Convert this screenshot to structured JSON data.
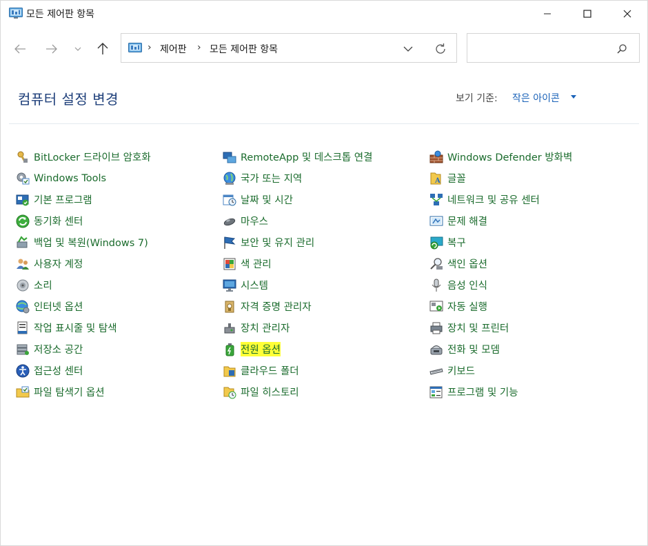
{
  "window": {
    "title": "모든 제어판 항목",
    "controls": [
      "minimize",
      "maximize",
      "close"
    ]
  },
  "nav": {
    "back_icon": "arrow-left-icon",
    "forward_icon": "arrow-right-icon",
    "recent_icon": "chevron-down-icon",
    "up_icon": "arrow-up-icon"
  },
  "address": {
    "crumbs": [
      "제어판",
      "모든 제어판 항목"
    ],
    "separator": "›"
  },
  "search": {
    "placeholder": ""
  },
  "header": {
    "title": "컴퓨터 설정 변경",
    "view_label": "보기 기준:",
    "view_value": "작은 아이콘"
  },
  "columns": [
    [
      {
        "label": "BitLocker 드라이브 암호화",
        "icon": "bitlocker-key-icon"
      },
      {
        "label": "Windows Tools",
        "icon": "windows-tools-gear-icon"
      },
      {
        "label": "기본 프로그램",
        "icon": "default-programs-icon"
      },
      {
        "label": "동기화 센터",
        "icon": "sync-center-icon"
      },
      {
        "label": "백업 및 복원(Windows 7)",
        "icon": "backup-restore-icon"
      },
      {
        "label": "사용자 계정",
        "icon": "user-accounts-icon"
      },
      {
        "label": "소리",
        "icon": "speaker-icon"
      },
      {
        "label": "인터넷 옵션",
        "icon": "internet-options-icon"
      },
      {
        "label": "작업 표시줄 및 탐색",
        "icon": "taskbar-icon"
      },
      {
        "label": "저장소 공간",
        "icon": "storage-spaces-icon"
      },
      {
        "label": "접근성 센터",
        "icon": "ease-of-access-icon"
      },
      {
        "label": "파일 탐색기 옵션",
        "icon": "folder-options-icon"
      }
    ],
    [
      {
        "label": "RemoteApp 및 데스크톱 연결",
        "icon": "remoteapp-icon"
      },
      {
        "label": "국가 또는 지역",
        "icon": "region-globe-icon"
      },
      {
        "label": "날짜 및 시간",
        "icon": "date-time-icon"
      },
      {
        "label": "마우스",
        "icon": "mouse-icon"
      },
      {
        "label": "보안 및 유지 관리",
        "icon": "security-flag-icon"
      },
      {
        "label": "색 관리",
        "icon": "color-management-icon"
      },
      {
        "label": "시스템",
        "icon": "system-monitor-icon"
      },
      {
        "label": "자격 증명 관리자",
        "icon": "credential-manager-icon"
      },
      {
        "label": "장치 관리자",
        "icon": "device-manager-icon"
      },
      {
        "label": "전원 옵션",
        "icon": "power-options-icon",
        "highlighted": true
      },
      {
        "label": "클라우드 폴더",
        "icon": "work-folders-icon"
      },
      {
        "label": "파일 히스토리",
        "icon": "file-history-icon"
      }
    ],
    [
      {
        "label": "Windows Defender 방화벽",
        "icon": "firewall-icon"
      },
      {
        "label": "글꼴",
        "icon": "fonts-folder-icon"
      },
      {
        "label": "네트워크 및 공유 센터",
        "icon": "network-icon"
      },
      {
        "label": "문제 해결",
        "icon": "troubleshooting-icon"
      },
      {
        "label": "복구",
        "icon": "recovery-icon"
      },
      {
        "label": "색인 옵션",
        "icon": "indexing-icon"
      },
      {
        "label": "음성 인식",
        "icon": "microphone-icon"
      },
      {
        "label": "자동 실행",
        "icon": "autoplay-icon"
      },
      {
        "label": "장치 및 프린터",
        "icon": "printer-icon"
      },
      {
        "label": "전화 및 모뎀",
        "icon": "phone-modem-icon"
      },
      {
        "label": "키보드",
        "icon": "keyboard-icon"
      },
      {
        "label": "프로그램 및 기능",
        "icon": "programs-features-icon"
      }
    ]
  ],
  "colors": {
    "title_blue": "#1e3f7a",
    "link_green": "#1a6b2c",
    "link_blue": "#1a62b8",
    "highlight": "#ffff37"
  }
}
